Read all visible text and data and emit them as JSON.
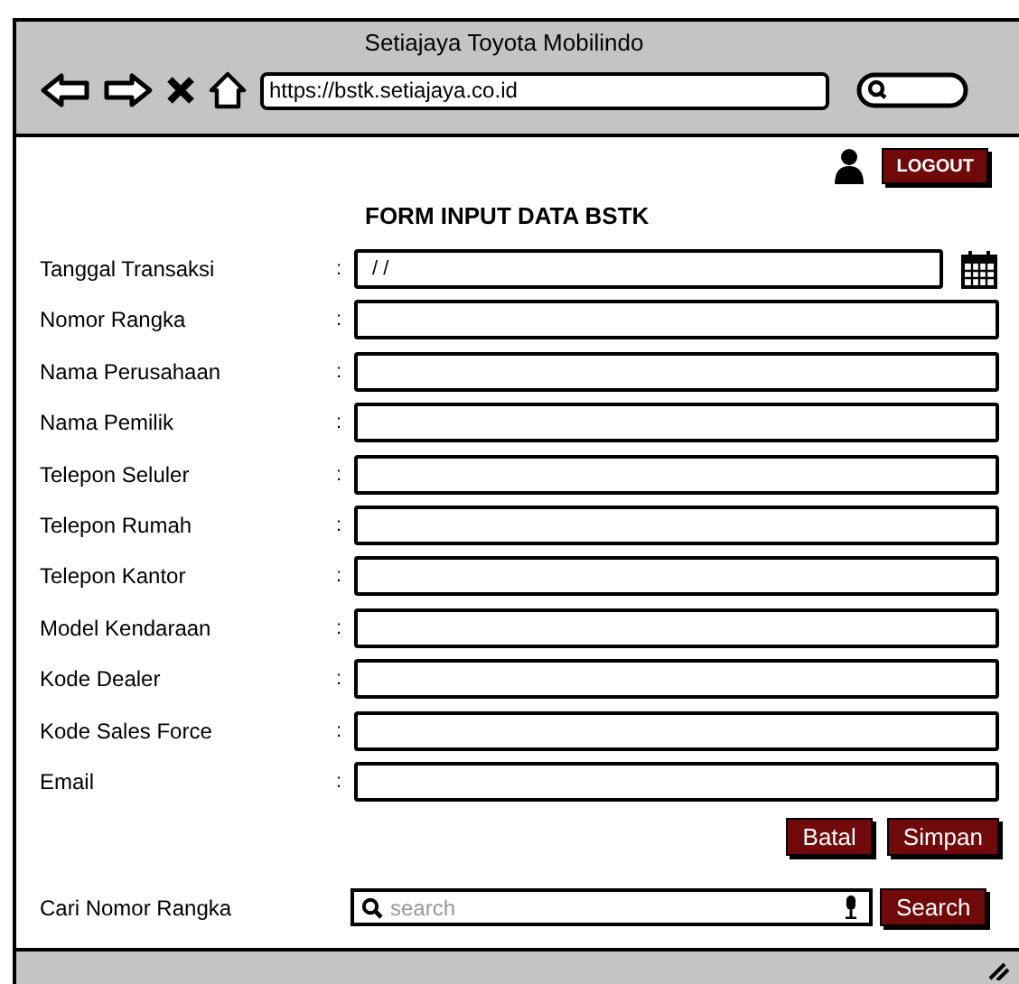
{
  "window": {
    "title": "Setiajaya Toyota Mobilindo"
  },
  "browser": {
    "url": "https://bstk.setiajaya.co.id"
  },
  "header": {
    "logout": "LOGOUT"
  },
  "form": {
    "title": "FORM INPUT DATA BSTK",
    "fields": [
      {
        "label": "Tanggal Transaksi",
        "colon": ":",
        "kind": "date",
        "value": "/ /"
      },
      {
        "label": "Nomor Rangka",
        "colon": ":",
        "kind": "text"
      },
      {
        "label": "Nama Perusahaan",
        "colon": ":",
        "kind": "text"
      },
      {
        "label": "Nama Pemilik",
        "colon": ":",
        "kind": "text"
      },
      {
        "label": "Telepon Seluler",
        "colon": ":",
        "kind": "text"
      },
      {
        "label": "Telepon Rumah",
        "colon": ":",
        "kind": "text"
      },
      {
        "label": "Telepon Kantor",
        "colon": ":",
        "kind": "text"
      },
      {
        "label": "Model Kendaraan",
        "colon": ":",
        "kind": "text"
      },
      {
        "label": "Kode Dealer",
        "colon": ":",
        "kind": "text"
      },
      {
        "label": "Kode Sales Force",
        "colon": ":",
        "kind": "text"
      },
      {
        "label": "Email",
        "colon": ":",
        "kind": "text"
      }
    ],
    "buttons": [
      "Batal",
      "Simpan"
    ]
  },
  "search": {
    "label": "Cari Nomor Rangka",
    "placeholder": "search",
    "button": "Search"
  }
}
